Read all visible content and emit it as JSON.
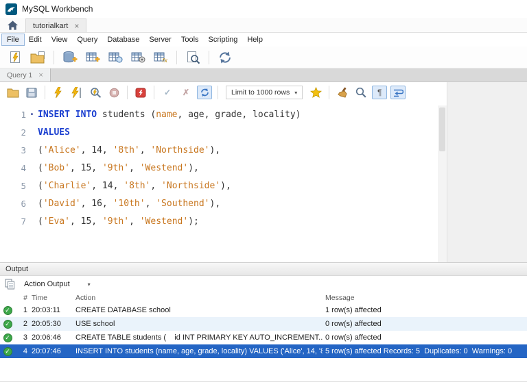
{
  "window": {
    "title": "MySQL Workbench"
  },
  "doc_tab": {
    "label": "tutorialkart"
  },
  "query_tab": {
    "label": "Query 1"
  },
  "menu": {
    "items": [
      "File",
      "Edit",
      "View",
      "Query",
      "Database",
      "Server",
      "Tools",
      "Scripting",
      "Help"
    ],
    "focused_item": "File"
  },
  "main_toolbar": {
    "icon_names": [
      "new-sql-tab-icon",
      "open-sql-script-icon",
      "create-schema-icon",
      "create-table-icon",
      "create-view-icon",
      "create-procedure-icon",
      "create-function-icon",
      "search-table-data-icon",
      "reconnect-dbms-icon"
    ]
  },
  "editor_toolbar": {
    "limit_label": "Limit to 1000 rows",
    "icon_names": [
      "open-file-icon",
      "save-script-icon",
      "execute-icon",
      "execute-current-icon",
      "explain-icon",
      "stop-icon",
      "stop-on-error-icon",
      "commit-icon",
      "rollback-icon",
      "autocommit-icon",
      "save-snippet-icon",
      "beautify-icon",
      "find-icon",
      "invisible-chars-icon",
      "wrap-text-icon"
    ]
  },
  "glyphs": {
    "close": "×",
    "dropdown": "▾",
    "bullet": "•",
    "check": "✓",
    "cross": "✗",
    "pilcrow": "¶"
  },
  "editor": {
    "lines": [
      {
        "marker": true,
        "segments": [
          {
            "c": "kw",
            "t": "INSERT INTO"
          },
          {
            "c": "pl",
            "t": " students ("
          },
          {
            "c": "str",
            "t": "name"
          },
          {
            "c": "pl",
            "t": ", age, grade, locality)"
          }
        ]
      },
      {
        "segments": [
          {
            "c": "kw",
            "t": "VALUES"
          }
        ]
      },
      {
        "segments": [
          {
            "c": "pl",
            "t": "("
          },
          {
            "c": "str",
            "t": "'Alice'"
          },
          {
            "c": "pl",
            "t": ", 14, "
          },
          {
            "c": "str",
            "t": "'8th'"
          },
          {
            "c": "pl",
            "t": ", "
          },
          {
            "c": "str",
            "t": "'Northside'"
          },
          {
            "c": "pl",
            "t": "),"
          }
        ]
      },
      {
        "segments": [
          {
            "c": "pl",
            "t": "("
          },
          {
            "c": "str",
            "t": "'Bob'"
          },
          {
            "c": "pl",
            "t": ", 15, "
          },
          {
            "c": "str",
            "t": "'9th'"
          },
          {
            "c": "pl",
            "t": ", "
          },
          {
            "c": "str",
            "t": "'Westend'"
          },
          {
            "c": "pl",
            "t": "),"
          }
        ]
      },
      {
        "segments": [
          {
            "c": "pl",
            "t": "("
          },
          {
            "c": "str",
            "t": "'Charlie'"
          },
          {
            "c": "pl",
            "t": ", 14, "
          },
          {
            "c": "str",
            "t": "'8th'"
          },
          {
            "c": "pl",
            "t": ", "
          },
          {
            "c": "str",
            "t": "'Northside'"
          },
          {
            "c": "pl",
            "t": "),"
          }
        ]
      },
      {
        "segments": [
          {
            "c": "pl",
            "t": "("
          },
          {
            "c": "str",
            "t": "'David'"
          },
          {
            "c": "pl",
            "t": ", 16, "
          },
          {
            "c": "str",
            "t": "'10th'"
          },
          {
            "c": "pl",
            "t": ", "
          },
          {
            "c": "str",
            "t": "'Southend'"
          },
          {
            "c": "pl",
            "t": "),"
          }
        ]
      },
      {
        "segments": [
          {
            "c": "pl",
            "t": "("
          },
          {
            "c": "str",
            "t": "'Eva'"
          },
          {
            "c": "pl",
            "t": ", 15, "
          },
          {
            "c": "str",
            "t": "'9th'"
          },
          {
            "c": "pl",
            "t": ", "
          },
          {
            "c": "str",
            "t": "'Westend'"
          },
          {
            "c": "pl",
            "t": ");"
          }
        ]
      }
    ]
  },
  "output": {
    "panel_title": "Output",
    "view_selector_label": "Action Output",
    "columns": [
      "#",
      "Time",
      "Action",
      "Message"
    ],
    "rows": [
      {
        "num": "1",
        "time": "20:03:11",
        "action": "CREATE DATABASE school",
        "message": "1 row(s) affected",
        "status": "success",
        "selected": false
      },
      {
        "num": "2",
        "time": "20:05:30",
        "action": "USE school",
        "message": "0 row(s) affected",
        "status": "success",
        "selected": false
      },
      {
        "num": "3",
        "time": "20:06:46",
        "action": "CREATE TABLE students (    id INT PRIMARY KEY AUTO_INCREMENT...",
        "message": "0 row(s) affected",
        "status": "success",
        "selected": false
      },
      {
        "num": "4",
        "time": "20:07:46",
        "action": "INSERT INTO students (name, age, grade, locality) VALUES ('Alice', 14, '8...",
        "message": "5 row(s) affected Records: 5  Duplicates: 0  Warnings: 0",
        "status": "success",
        "selected": true
      }
    ]
  },
  "colors": {
    "keyword_blue": "#1b3fd0",
    "string_orange": "#c8761e",
    "selected_row_blue": "#2465c4",
    "status_success_green": "#3da84a"
  }
}
